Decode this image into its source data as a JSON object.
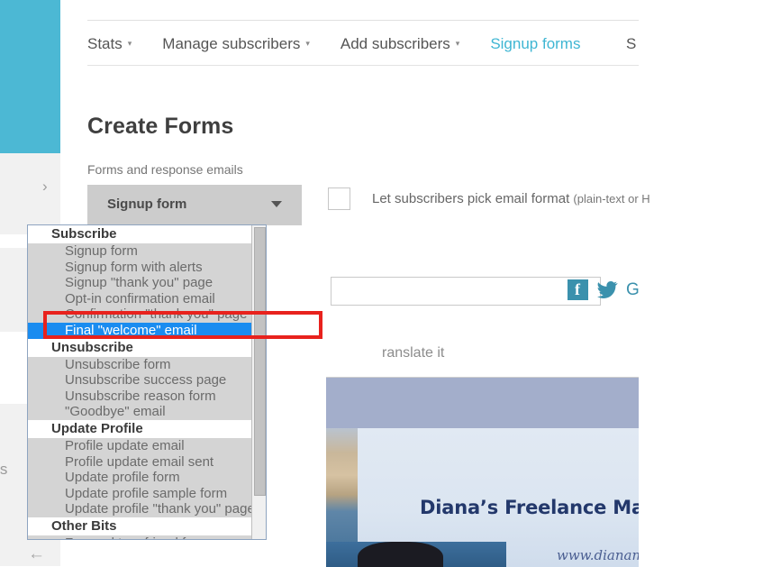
{
  "left_chrome": {
    "chevron_icon": "chevron-right",
    "cut_text": "rs",
    "back_arrow_icon": "arrow-left",
    "teal_color": "#4cb8d4"
  },
  "nav": {
    "items": [
      {
        "label": "Stats",
        "has_caret": true,
        "active": false
      },
      {
        "label": "Manage subscribers",
        "has_caret": true,
        "active": false
      },
      {
        "label": "Add subscribers",
        "has_caret": true,
        "active": false
      },
      {
        "label": "Signup forms",
        "has_caret": false,
        "active": true
      }
    ],
    "cut_off_item": "S",
    "caret_glyph": "▾",
    "active_color": "#3fb6d3"
  },
  "page": {
    "title": "Create Forms",
    "forms_label": "Forms and response emails"
  },
  "select": {
    "value": "Signup form",
    "caret_icon": "chevron-down-icon"
  },
  "checkbox": {
    "checked": false,
    "label": "Let subscribers pick email format ",
    "label_sub": "(plain-text or H"
  },
  "text_input": {
    "value": "",
    "placeholder": ""
  },
  "social": {
    "facebook_glyph": "f",
    "twitter_name": "twitter-icon",
    "googleplus_glyph": "G",
    "color": "#3b91ad"
  },
  "translate_text": "ranslate it",
  "preview": {
    "title": "Diana’s Freelance Marketing",
    "url": "www.dianamarinov",
    "band_color": "#a3aecb"
  },
  "dropdown": {
    "selected": "Final \"welcome\" email",
    "groups": [
      {
        "label": "Subscribe",
        "items": [
          "Signup form",
          "Signup form with alerts",
          "Signup \"thank you\" page",
          "Opt-in confirmation email",
          "Confirmation \"thank you\" page",
          "Final \"welcome\" email"
        ]
      },
      {
        "label": "Unsubscribe",
        "items": [
          "Unsubscribe form",
          "Unsubscribe success page",
          "Unsubscribe reason form",
          "\"Goodbye\" email"
        ]
      },
      {
        "label": "Update Profile",
        "items": [
          "Profile update email",
          "Profile update email sent",
          "Update profile form",
          "Update profile sample form",
          "Update profile \"thank you\" page"
        ]
      },
      {
        "label": "Other Bits",
        "items": [
          "Forward to a friend form"
        ]
      }
    ]
  },
  "annotation": {
    "color": "#e8221d",
    "shape": "rectangle"
  }
}
